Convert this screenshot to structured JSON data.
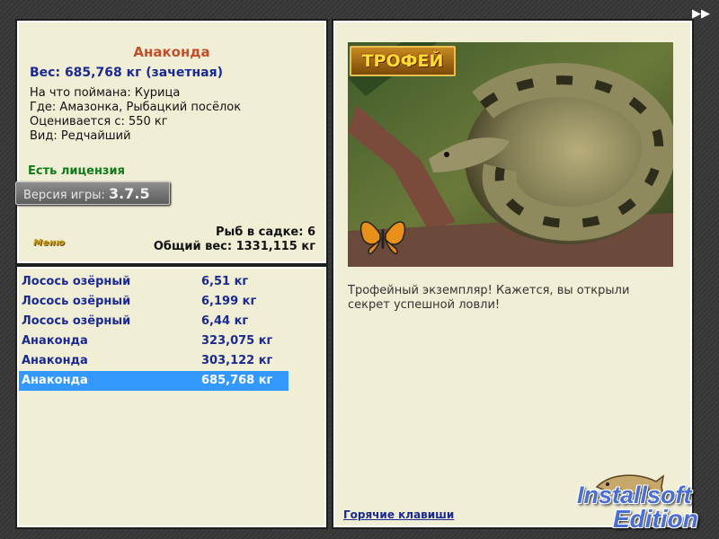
{
  "info": {
    "fish_name": "Анаконда",
    "weight_line": "Вес: 685,768 кг (зачетная)",
    "caught_on": "На что поймана: Курица",
    "location": "Где: Амазонка, Рыбацкий посёлок",
    "valued_from": "Оценивается с: 550 кг",
    "rarity": "Вид: Редчайший",
    "license": "Есть лицензия",
    "version_label": "Версия игры:",
    "version_number": "3.7.5",
    "fish_in_keepnet": "Рыб в садке: 6",
    "total_weight": "Общий вес: 1331,115 кг",
    "menu_label": "Меню"
  },
  "catch_list": [
    {
      "name": "Лосось озёрный",
      "weight": "6,51 кг"
    },
    {
      "name": "Лосось озёрный",
      "weight": "6,199 кг"
    },
    {
      "name": "Лосось озёрный",
      "weight": "6,44 кг"
    },
    {
      "name": "Анаконда",
      "weight": "323,075 кг"
    },
    {
      "name": "Анаконда",
      "weight": "303,122 кг"
    },
    {
      "name": "Анаконда",
      "weight": "685,768 кг"
    }
  ],
  "selected_index": 5,
  "trophy": {
    "badge": "ТРОФЕЙ",
    "description": "Трофейный экземпляр! Кажется, вы открыли секрет успешной ловли!",
    "hotkeys": "Горячие клавиши"
  },
  "watermark": {
    "line1": "Installsoft",
    "line2": "Edition"
  },
  "colors": {
    "panel_bg": "#f1eed6",
    "selected_row": "#3399ff",
    "title_orange": "#c0502a",
    "text_blue": "#1a2a90",
    "license_green": "#117a1a"
  }
}
